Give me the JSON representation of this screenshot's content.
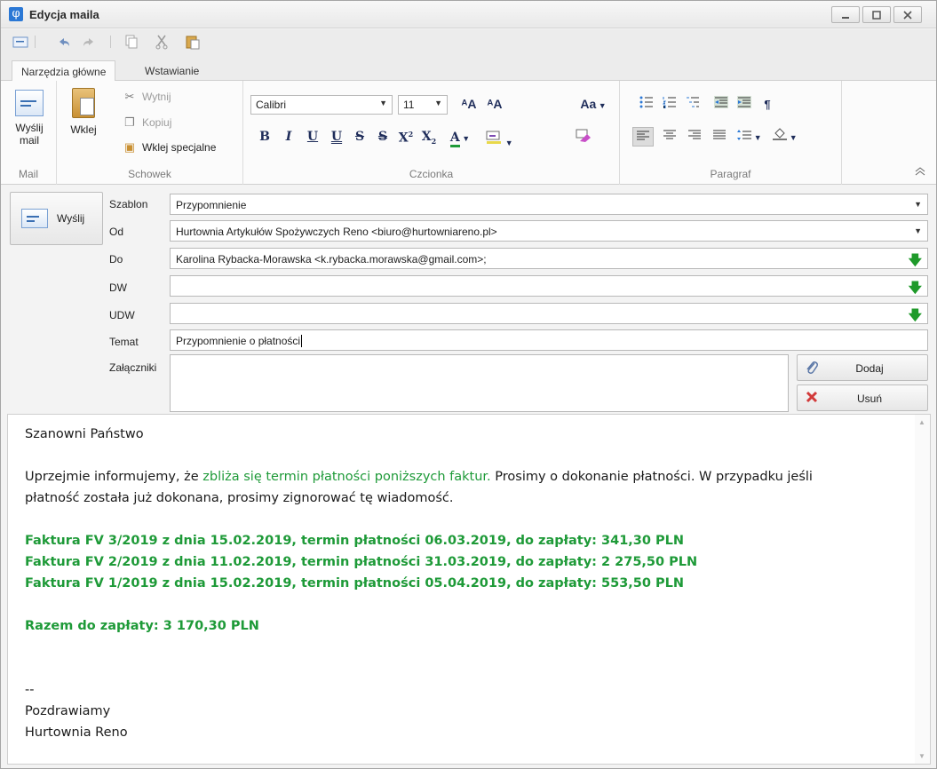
{
  "window": {
    "title": "Edycja maila",
    "app_icon": "φ"
  },
  "ribbon": {
    "tabs": [
      "Narzędzia główne",
      "Wstawianie"
    ],
    "mail": {
      "send_label_line1": "Wyślij",
      "send_label_line2": "mail",
      "group_label": "Mail"
    },
    "clipboard": {
      "paste": "Wklej",
      "cut": "Wytnij",
      "copy": "Kopiuj",
      "paste_special": "Wklej specjalne",
      "group_label": "Schowek"
    },
    "font": {
      "family": "Calibri",
      "size": "11",
      "group_label": "Czcionka",
      "case_label": "Aa"
    },
    "paragraph": {
      "group_label": "Paragraf"
    }
  },
  "form": {
    "send_button": "Wyślij",
    "labels": {
      "template": "Szablon",
      "from": "Od",
      "to": "Do",
      "cc": "DW",
      "bcc": "UDW",
      "subject": "Temat",
      "attachments": "Załączniki"
    },
    "values": {
      "template": "Przypomnienie",
      "from": "Hurtownia Artykułów Spożywczych Reno <biuro@hurtowniareno.pl>",
      "to": "Karolina Rybacka-Morawska <k.rybacka.morawska@gmail.com>;",
      "cc": "",
      "bcc": "",
      "subject": "Przypomnienie o płatności"
    },
    "add_button": "Dodaj",
    "remove_button": "Usuń"
  },
  "body": {
    "greeting": "Szanowni Państwo",
    "intro_prefix": "Uprzejmie informujemy, że ",
    "intro_highlight": "zbliża się termin płatności poniższych faktur.",
    "intro_suffix": " Prosimy o dokonanie płatności. W przypadku jeśli",
    "intro_line2": "płatność została już dokonana, prosimy zignorować tę wiadomość.",
    "invoices": [
      "Faktura FV 3/2019 z dnia 15.02.2019, termin płatności 06.03.2019, do zapłaty: 341,30 PLN",
      "Faktura FV 2/2019 z dnia 11.02.2019, termin płatności 31.03.2019, do zapłaty: 2 275,50 PLN",
      "Faktura FV 1/2019 z dnia 15.02.2019, termin płatności 05.04.2019, do zapłaty: 553,50 PLN"
    ],
    "total": "Razem do zapłaty: 3 170,30 PLN",
    "signature_sep": "--",
    "signature_line1": "Pozdrawiamy",
    "signature_line2": "Hurtownia Reno"
  },
  "colors": {
    "highlight_green": "#1e9a38",
    "accent_blue": "#2b78d5"
  }
}
